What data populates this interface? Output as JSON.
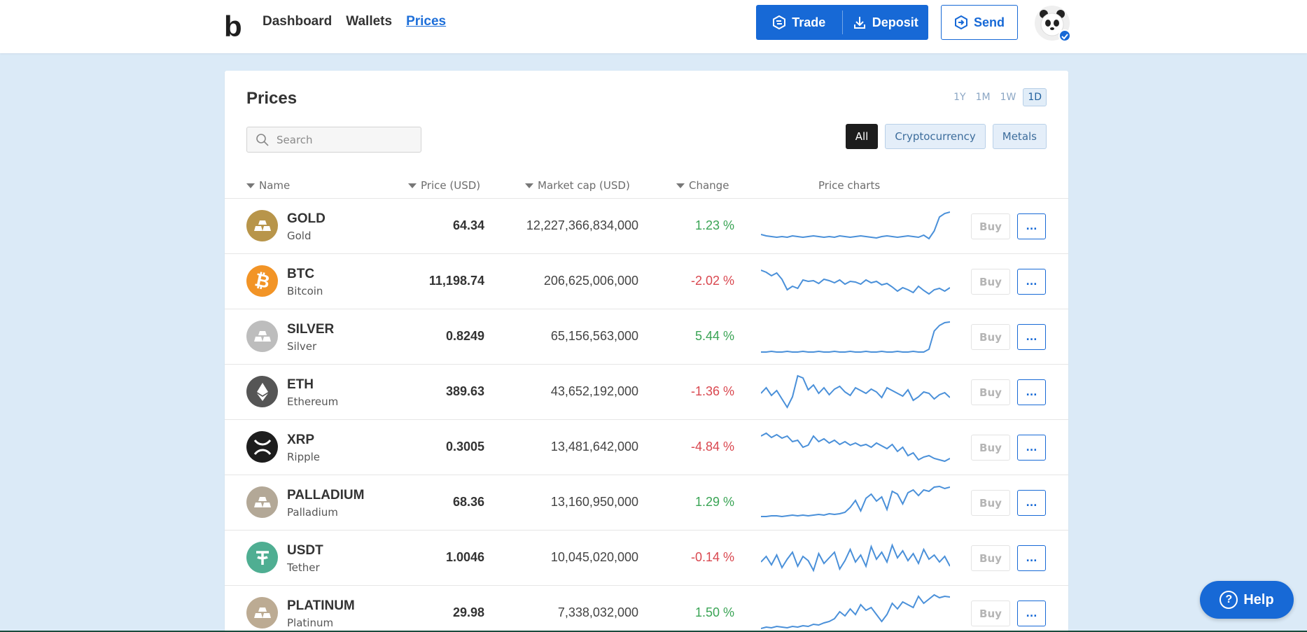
{
  "nav": {
    "logo": "b",
    "items": [
      "Dashboard",
      "Wallets",
      "Prices"
    ],
    "active": "Prices"
  },
  "header": {
    "trade_label": "Trade",
    "deposit_label": "Deposit",
    "send_label": "Send"
  },
  "page": {
    "title": "Prices",
    "periods": [
      "1Y",
      "1M",
      "1W",
      "1D"
    ],
    "active_period": "1D",
    "search_placeholder": "Search",
    "filters": [
      "All",
      "Cryptocurrency",
      "Metals"
    ],
    "active_filter": "All"
  },
  "table": {
    "headers": {
      "name": "Name",
      "price": "Price (USD)",
      "mcap": "Market cap (USD)",
      "change": "Change",
      "charts": "Price charts"
    },
    "rows": [
      {
        "symbol": "GOLD",
        "name": "Gold",
        "price": "64.34",
        "mcap": "12,227,366,834,000",
        "change": "1.23 %",
        "dir": "up",
        "icon": "gold-bars-icon",
        "color": "#b8954a"
      },
      {
        "symbol": "BTC",
        "name": "Bitcoin",
        "price": "11,198.74",
        "mcap": "206,625,006,000",
        "change": "-2.02 %",
        "dir": "dn",
        "icon": "bitcoin-icon",
        "color": "#f29426"
      },
      {
        "symbol": "SILVER",
        "name": "Silver",
        "price": "0.8249",
        "mcap": "65,156,563,000",
        "change": "5.44 %",
        "dir": "up",
        "icon": "silver-bars-icon",
        "color": "#bdbdbd"
      },
      {
        "symbol": "ETH",
        "name": "Ethereum",
        "price": "389.63",
        "mcap": "43,652,192,000",
        "change": "-1.36 %",
        "dir": "dn",
        "icon": "ethereum-icon",
        "color": "#555555"
      },
      {
        "symbol": "XRP",
        "name": "Ripple",
        "price": "0.3005",
        "mcap": "13,481,642,000",
        "change": "-4.84 %",
        "dir": "dn",
        "icon": "xrp-icon",
        "color": "#1d1d1d"
      },
      {
        "symbol": "PALLADIUM",
        "name": "Palladium",
        "price": "68.36",
        "mcap": "13,160,950,000",
        "change": "1.29 %",
        "dir": "up",
        "icon": "palladium-bars-icon",
        "color": "#b3a897"
      },
      {
        "symbol": "USDT",
        "name": "Tether",
        "price": "1.0046",
        "mcap": "10,045,020,000",
        "change": "-0.14 %",
        "dir": "dn",
        "icon": "tether-icon",
        "color": "#4fae92"
      },
      {
        "symbol": "PLATINUM",
        "name": "Platinum",
        "price": "29.98",
        "mcap": "7,338,032,000",
        "change": "1.50 %",
        "dir": "up",
        "icon": "platinum-bars-icon",
        "color": "#bcab93"
      }
    ],
    "buy_label": "Buy",
    "more_label": "..."
  },
  "help_label": "Help",
  "colors": {
    "accent": "#1769d6",
    "up": "#3aa455",
    "down": "#d9474f",
    "background": "#dbeaf7"
  }
}
